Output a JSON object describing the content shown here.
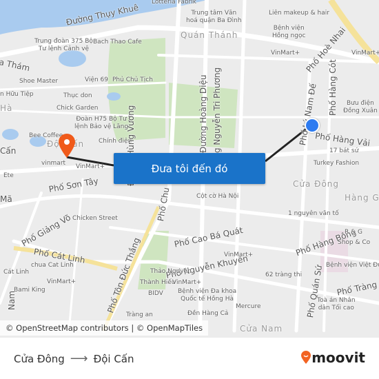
{
  "map": {
    "labels": [
      {
        "text": "Đường Thụy Khuê",
        "kind": "st"
      },
      {
        "text": "Lotteria",
        "kind": "poi"
      },
      {
        "text": "Fabrik",
        "kind": "poi"
      },
      {
        "text": "Trung tâm Văn\nhoá quận Ba Đình",
        "kind": "poi"
      },
      {
        "text": "Liên makeup & hair",
        "kind": "poi"
      },
      {
        "text": "Quán Thánh",
        "kind": "area"
      },
      {
        "text": "Bệnh viện\nHồng ngọc",
        "kind": "poi"
      },
      {
        "text": "Phố Hoè Nhai",
        "kind": "st"
      },
      {
        "text": "VinMart+",
        "kind": "poi"
      },
      {
        "text": "VinMart+",
        "kind": "poi"
      },
      {
        "text": "Trung đoàn 375 Bộ\nTư lệnh Cảnh vệ",
        "kind": "poi"
      },
      {
        "text": "Bach Thao Cafe",
        "kind": "poi"
      },
      {
        "text": "a Thám",
        "kind": "st"
      },
      {
        "text": "Shoe Master",
        "kind": "poi"
      },
      {
        "text": "Viện 69",
        "kind": "poi"
      },
      {
        "text": "Phủ Chủ Tịch",
        "kind": "poi"
      },
      {
        "text": "n Hữu Tiệp",
        "kind": "poi"
      },
      {
        "text": "Thục don",
        "kind": "poi"
      },
      {
        "text": "Hà",
        "kind": "area"
      },
      {
        "text": "Chick Garden",
        "kind": "poi"
      },
      {
        "text": "Đoàn H75 Bộ Tư\nlệnh Bảo vệ Lăng",
        "kind": "poi"
      },
      {
        "text": "Bee Coffee",
        "kind": "poi"
      },
      {
        "text": "Chính điện",
        "kind": "poi"
      },
      {
        "text": "Đội Cấn",
        "kind": "area"
      },
      {
        "text": "Cấn",
        "kind": "st"
      },
      {
        "text": "vinmart",
        "kind": "poi"
      },
      {
        "text": "VinMart+",
        "kind": "poi"
      },
      {
        "text": "Phố Sơn Tây",
        "kind": "st"
      },
      {
        "text": "Đường Hoàng Diệu",
        "kind": "st"
      },
      {
        "text": "g Nguyễn Tri Phương",
        "kind": "st"
      },
      {
        "text": "Đường Hùng Vương",
        "kind": "st"
      },
      {
        "text": "Phố Lý Nam Đế",
        "kind": "st"
      },
      {
        "text": "Phố Hàng Cót",
        "kind": "st"
      },
      {
        "text": "Bưu điện\nĐồng Xuân",
        "kind": "poi"
      },
      {
        "text": "Phố Hàng Vải",
        "kind": "st"
      },
      {
        "text": "17 bát sứ",
        "kind": "poi"
      },
      {
        "text": "Turkey Fashion",
        "kind": "poi"
      },
      {
        "text": "Cửa Đông",
        "kind": "area"
      },
      {
        "text": "Hàng Ga",
        "kind": "area"
      },
      {
        "text": "Cột cờ Hà Nội",
        "kind": "poi"
      },
      {
        "text": "1 nguyên văn tố",
        "kind": "poi"
      },
      {
        "text": "Phố Hàng Bông",
        "kind": "st"
      },
      {
        "text": "R & G",
        "kind": "poi"
      },
      {
        "text": "Shop & Co",
        "kind": "poi"
      },
      {
        "text": "Bệnh viện Việt Đức",
        "kind": "poi"
      },
      {
        "text": "Phố Tràng",
        "kind": "st"
      },
      {
        "text": "Phố Cao Bá Quát",
        "kind": "st"
      },
      {
        "text": "Phố Nguyễn Khuyến",
        "kind": "st"
      },
      {
        "text": "Chicken Street",
        "kind": "poi"
      },
      {
        "text": "Phố Giảng Võ",
        "kind": "st"
      },
      {
        "text": "Phố Cát Linh",
        "kind": "st"
      },
      {
        "text": "chua Cat Linh",
        "kind": "poi"
      },
      {
        "text": "Cát Linh",
        "kind": "poi"
      },
      {
        "text": "VinMart+",
        "kind": "poi"
      },
      {
        "text": "Bami King",
        "kind": "poi"
      },
      {
        "text": "Phố Tôn Đức Thắng",
        "kind": "st"
      },
      {
        "text": "Phố Chu",
        "kind": "st"
      },
      {
        "text": "Thảo Nguyên",
        "kind": "poi"
      },
      {
        "text": "Thành Hiếu",
        "kind": "poi"
      },
      {
        "text": "BIDV",
        "kind": "poi"
      },
      {
        "text": "VinMart+",
        "kind": "poi"
      },
      {
        "text": "VinMart+",
        "kind": "poi"
      },
      {
        "text": "62 tràng thi",
        "kind": "poi"
      },
      {
        "text": "Bệnh viện Đa khoa\nQuốc tế Hồng Hà",
        "kind": "poi"
      },
      {
        "text": "Mercure",
        "kind": "poi"
      },
      {
        "text": "Tràng an",
        "kind": "poi"
      },
      {
        "text": "Đền Hàng Cả",
        "kind": "poi"
      },
      {
        "text": "Cửa Nam",
        "kind": "area"
      },
      {
        "text": "Phố Quán Sứ",
        "kind": "st"
      },
      {
        "text": "Toà án Nhân\ndân Tối cao",
        "kind": "poi"
      },
      {
        "text": "Ete",
        "kind": "poi"
      },
      {
        "text": "Mã",
        "kind": "st"
      },
      {
        "text": "Nam",
        "kind": "st"
      }
    ],
    "origin_marker": "blue-dot",
    "destination_marker": "orange-pin",
    "route_color": "#222222"
  },
  "cta": {
    "label": "Đưa tôi đến đó",
    "color": "#1a73c9"
  },
  "attribution": "© OpenStreetMap contributors | © OpenMapTiles",
  "footer": {
    "from": "Cửa Đông",
    "arrow": "⟶",
    "to": "Đội Cấn",
    "brand": "moovit",
    "brand_color": "#f26322"
  }
}
